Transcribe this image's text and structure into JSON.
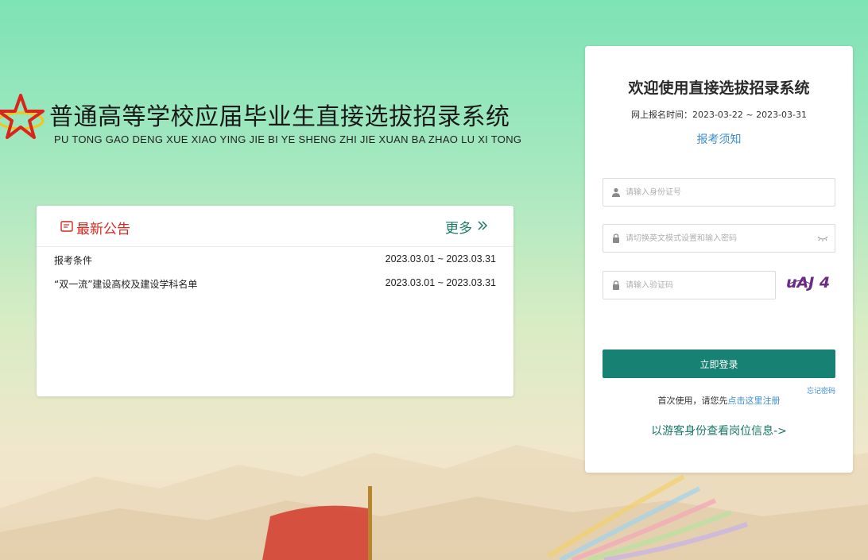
{
  "header": {
    "title": "普通高等学校应届毕业生直接选拔招录系统",
    "subtitle": "PU TONG GAO DENG XUE XIAO YING JIE BI YE SHENG ZHI JIE XUAN BA ZHAO LU XI TONG"
  },
  "notices": {
    "title": "最新公告",
    "more_label": "更多",
    "items": [
      {
        "title": "报考条件",
        "date": "2023.03.01 ~ 2023.03.31"
      },
      {
        "title": "“双一流”建设高校及建设学科名单",
        "date": "2023.03.01 ~ 2023.03.31"
      }
    ]
  },
  "login": {
    "title": "欢迎使用直接选拔招录系统",
    "reg_time": "网上报名时间：2023-03-22 ~ 2023-03-31",
    "guide_link": "报考须知",
    "id_placeholder": "请输入身份证号",
    "password_placeholder": "请切换英文模式设置和输入密码",
    "captcha_placeholder": "请输入验证码",
    "captcha_text": "uAJ 4",
    "login_button": "立即登录",
    "forgot_password": "忘记密码",
    "first_use_prefix": "首次使用，请您先",
    "register_link": "点击这里注册",
    "guest_link": "以游客身份查看岗位信息->"
  },
  "colors": {
    "primary": "#178273",
    "link_blue": "#3b8fd6",
    "notice_red": "#d9261c",
    "star_red": "#d9261c",
    "star_gold": "#f5c518"
  },
  "icons": {
    "logo": "red-star-logo-icon",
    "notice": "notice-card-icon",
    "more": "double-chevron-right-icon",
    "id_field": "user-icon",
    "password_field": "lock-icon",
    "captcha_field": "lock-icon",
    "password_toggle": "eye-closed-icon"
  }
}
